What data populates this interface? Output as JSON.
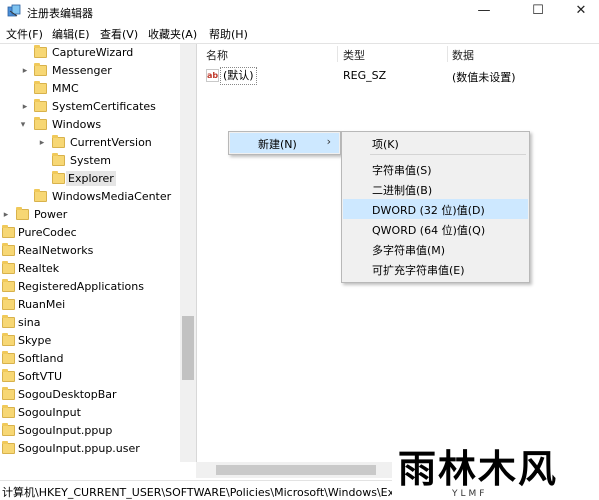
{
  "window": {
    "title": "注册表编辑器",
    "controls": {
      "minimize": "—",
      "maximize": "☐",
      "close": "✕"
    }
  },
  "menubar": [
    "文件(F)",
    "编辑(E)",
    "查看(V)",
    "收藏夹(A)",
    "帮助(H)"
  ],
  "tree": {
    "items": [
      {
        "label": "CaptureWizard",
        "arrow": ""
      },
      {
        "label": "Messenger",
        "arrow": "▸"
      },
      {
        "label": "MMC",
        "arrow": ""
      },
      {
        "label": "SystemCertificates",
        "arrow": "▸"
      },
      {
        "label": "Windows",
        "arrow": "▾"
      },
      {
        "label": "CurrentVersion",
        "arrow": "▸"
      },
      {
        "label": "System",
        "arrow": ""
      },
      {
        "label": "Explorer",
        "arrow": "",
        "selected": true
      },
      {
        "label": "WindowsMediaCenter",
        "arrow": ""
      },
      {
        "label": "Power",
        "arrow": "▸"
      },
      {
        "label": "PureCodec",
        "arrow": ""
      },
      {
        "label": "RealNetworks",
        "arrow": ""
      },
      {
        "label": "Realtek",
        "arrow": ""
      },
      {
        "label": "RegisteredApplications",
        "arrow": ""
      },
      {
        "label": "RuanMei",
        "arrow": ""
      },
      {
        "label": "sina",
        "arrow": ""
      },
      {
        "label": "Skype",
        "arrow": ""
      },
      {
        "label": "Softland",
        "arrow": ""
      },
      {
        "label": "SoftVTU",
        "arrow": ""
      },
      {
        "label": "SogouDesktopBar",
        "arrow": ""
      },
      {
        "label": "SogouInput",
        "arrow": ""
      },
      {
        "label": "SogouInput.ppup",
        "arrow": ""
      },
      {
        "label": "SogouInput.ppup.user",
        "arrow": ""
      }
    ]
  },
  "list": {
    "headers": {
      "name": "名称",
      "type": "类型",
      "data": "数据"
    },
    "rows": [
      {
        "icon": "ab",
        "name": "(默认)",
        "type": "REG_SZ",
        "data": "(数值未设置)"
      }
    ]
  },
  "context_menu": {
    "new": {
      "label": "新建(N)",
      "arrow": "›"
    },
    "submenu": [
      {
        "label": "项(K)"
      },
      {
        "label": "字符串值(S)"
      },
      {
        "label": "二进制值(B)"
      },
      {
        "label": "DWORD (32 位)值(D)",
        "highlighted": true
      },
      {
        "label": "QWORD (64 位)值(Q)"
      },
      {
        "label": "多字符串值(M)"
      },
      {
        "label": "可扩充字符串值(E)"
      }
    ]
  },
  "statusbar": {
    "path": "计算机\\HKEY_CURRENT_USER\\SOFTWARE\\Policies\\Microsoft\\Windows\\Explorer"
  },
  "watermark": {
    "text": "雨林木风",
    "sub": "YLMF"
  },
  "colors": {
    "highlight": "#cde8ff",
    "folder": "#f7d774",
    "selected_tree": "#e5e5e5"
  },
  "icons": {
    "app": "regedit-icon",
    "folder": "folder-icon",
    "string_value": "ab-icon"
  }
}
